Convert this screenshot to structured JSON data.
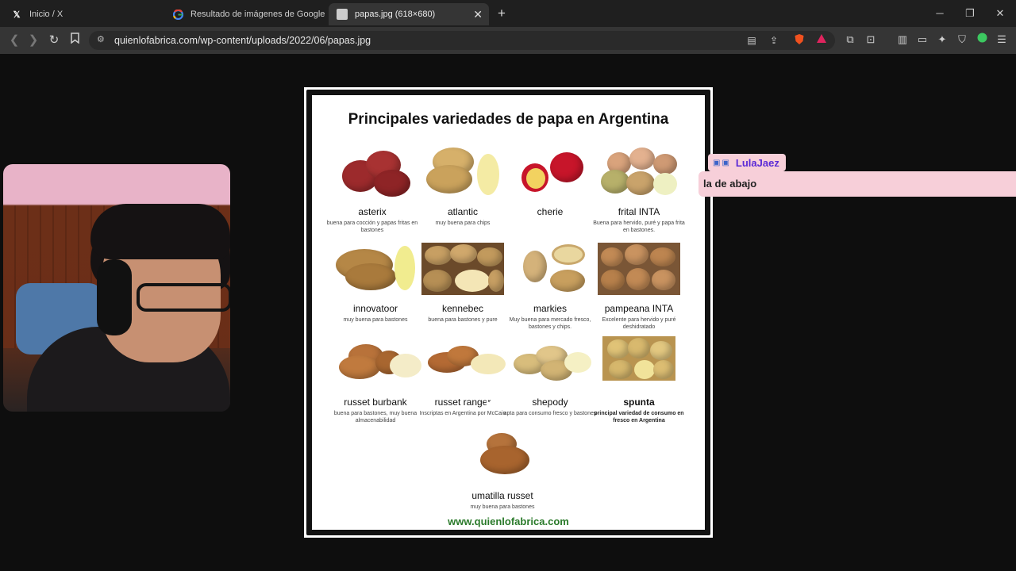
{
  "tabs": [
    {
      "label": "Inicio / X",
      "favicon": "x-logo-icon"
    },
    {
      "label": "Resultado de imágenes de Google",
      "favicon": "google-logo-icon"
    },
    {
      "label": "papas.jpg (618×680)",
      "favicon": "image-file-icon"
    }
  ],
  "address": {
    "url": "quienlofabrica.com/wp-content/uploads/2022/06/papas.jpg"
  },
  "poster": {
    "title": "Principales variedades de papa en Argentina",
    "footer": "www.quienlofabrica.com",
    "varieties": [
      {
        "name": "asterix",
        "desc": "buena para cocción y papas fritas en bastones"
      },
      {
        "name": "atlantic",
        "desc": "muy buena para chips"
      },
      {
        "name": "cherie",
        "desc": ""
      },
      {
        "name": "frital INTA",
        "desc": "Buena para hervido, puré y papa frita en bastones."
      },
      {
        "name": "innovatoor",
        "desc": "muy buena para bastones"
      },
      {
        "name": "kennebec",
        "desc": "buena para bastones y pure"
      },
      {
        "name": "markies",
        "desc": "Muy buena para mercado fresco, bastones y chips."
      },
      {
        "name": "pampeana INTA",
        "desc": "Excelente para hervido y puré deshidratado"
      },
      {
        "name": "russet burbank",
        "desc": "buena para bastones, muy buena almacenabilidad"
      },
      {
        "name": "russet ranger",
        "desc": "Inscriptas en Argentina por McCain"
      },
      {
        "name": "shepody",
        "desc": "apta para consumo fresco y bastones"
      },
      {
        "name": "spunta",
        "desc": "principal variedad de consumo en fresco en Argentina"
      },
      {
        "name": "umatilla russet",
        "desc": "muy buena para bastones"
      }
    ]
  },
  "chat": {
    "username": "LulaJaez",
    "message": "la de abajo"
  },
  "colors": {
    "chat_bg": "#f7cfd9",
    "username": "#5b2bd6",
    "footer_green": "#2a7a2a"
  }
}
